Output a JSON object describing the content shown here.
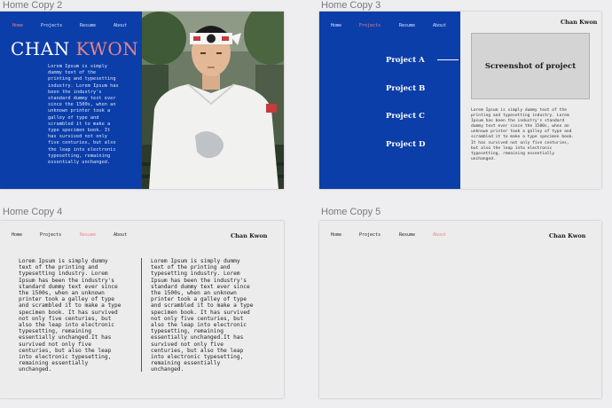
{
  "frames": [
    {
      "title": "Home Copy 2",
      "nav": [
        "Home",
        "Projects",
        "Resume",
        "About"
      ],
      "active_index": 0,
      "hero_first": "CHAN",
      "hero_last": "KWON",
      "paragraph": "Lorem Ipsum is simply\ndummy text of the\nprinting and typesetting\nindustry. Lorem Ipsum has\nbeen the industry's\nstandard dummy text ever\nsince the 1500s, when an\nunknown printer took a\ngalley of type and\nscrambled it to make a\ntype specimen book. It\nhas survived not only\nfive centuries, but also\nthe leap into electronic\ntypesetting, remaining\nessentially unchanged."
    },
    {
      "title": "Home Copy 3",
      "nav": [
        "Home",
        "Projects",
        "Resume",
        "About"
      ],
      "active_index": 1,
      "brand": "Chan Kwon",
      "projects": [
        "Project A",
        "Project B",
        "Project C",
        "Project D"
      ],
      "screenshot_label": "Screenshot of project",
      "paragraph": "Lorem Ipsum is simply dummy text of the\nprinting and typesetting industry. Lorem\nIpsum has been the industry's standard\ndummy text ever since the 1500s, when an\nunknown printer took a galley of type and\nscrambled it to make a type specimen book.\nIt has survived not only five centuries,\nbut also the leap into electronic\ntypesetting, remaining essentially\nunchanged."
    },
    {
      "title": "Home Copy 4",
      "nav": [
        "Home",
        "Projects",
        "Resume",
        "About"
      ],
      "active_index": 2,
      "brand": "Chan Kwon",
      "paragraph": "Lorem Ipsum is simply dummy\ntext of the printing and\ntypesetting industry. Lorem\nIpsum has been the industry's\nstandard dummy text ever since\nthe 1500s, when an unknown\nprinter took a galley of type\nand scrambled it to make a type\nspecimen book. It has survived\nnot only five centuries, but\nalso the leap into electronic\ntypesetting, remaining\nessentially unchanged.It has\nsurvived not only five\ncenturies, but also the leap\ninto electronic typesetting,\nremaining essentially\nunchanged."
    },
    {
      "title": "Home Copy 5",
      "nav": [
        "Home",
        "Projects",
        "Resume",
        "About"
      ],
      "active_index": 3,
      "brand": "Chan Kwon"
    }
  ],
  "colors": {
    "canvas": "#eeeef0",
    "blue": "#0b3ea9",
    "accent_pink": "#e8838d",
    "artboard_light": "#ececec"
  }
}
